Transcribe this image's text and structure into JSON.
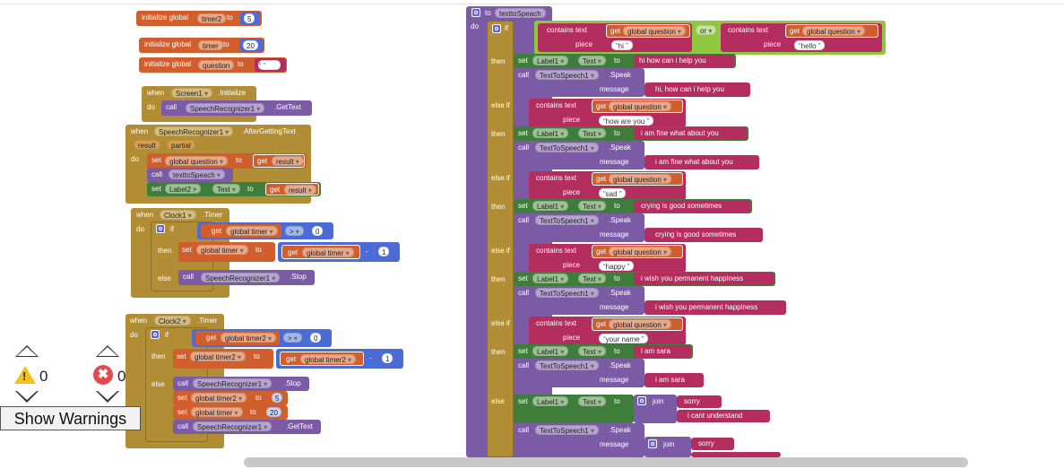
{
  "globals": [
    {
      "kw": "initialize global",
      "name": "timer2",
      "to": "to",
      "value": "5"
    },
    {
      "kw": "initialize global",
      "name": "timer",
      "to": "to",
      "value": "20"
    },
    {
      "kw": "initialize global",
      "name": "question",
      "to": "to",
      "value": ""
    }
  ],
  "kw": {
    "when": "when",
    "do": "do",
    "call": "call",
    "set": "set",
    "to": "to",
    "get": "get",
    "if": "if",
    "then": "then",
    "else": "else",
    "elseif": "else if",
    "result": "result",
    "partial": "partial",
    "contains": "contains text",
    "piece": "piece",
    "message": "message",
    "or": "or",
    "join": "join"
  },
  "screen_init": {
    "comp": "Screen1",
    "event": ".Initialize",
    "call_comp": "SpeechRecognizer1",
    "call_method": ".GetText"
  },
  "after_text": {
    "comp": "SpeechRecognizer1",
    "event": ".AfterGettingText",
    "set_var": "global question",
    "get_var": "result",
    "call_proc": "texttoSpeach",
    "label": "Label2",
    "prop": "Text",
    "get2": "result"
  },
  "clock1": {
    "comp": "Clock1",
    "event": ".Timer",
    "get_var": "global timer",
    "op": ">",
    "zero": "0",
    "set_var": "global timer",
    "get2": "global timer",
    "minus": "-",
    "one": "1",
    "else_comp": "SpeechRecognizer1",
    "else_method": ".Stop"
  },
  "clock2": {
    "comp": "Clock2",
    "event": ".Timer",
    "get_var": "global timer2",
    "op": ">",
    "zero": "0",
    "set_var": "global timer2",
    "get2": "global timer2",
    "minus": "-",
    "one": "1",
    "else_call1": "SpeechRecognizer1",
    "else_m1": ".Stop",
    "set1": "global timer2",
    "val1": "5",
    "set2": "global timer",
    "val2": "20",
    "else_call2": "SpeechRecognizer1",
    "else_m2": ".GetText"
  },
  "proc": {
    "kw": "to",
    "name": "texttoSpeach",
    "var": "global question",
    "label": "Label1",
    "prop": "Text",
    "tts": "TextToSpeech1",
    "speak": ".Speak",
    "if_pieces": [
      "hi",
      "hello"
    ],
    "branches": [
      {
        "piece": "hi",
        "text": "hi how can i help you",
        "message": "hi, how can i help you"
      },
      {
        "piece": "how are you",
        "text": "i am fine what about you",
        "message": "i am fine what about you"
      },
      {
        "piece": "sad",
        "text": "crying is good sometimes",
        "message": "crying is good sometimes"
      },
      {
        "piece": "happy",
        "text": "i wish you permanent happiness",
        "message": "i wish you permanent happiness"
      },
      {
        "piece": "your name",
        "text": "i am sara",
        "message": "i am sara"
      }
    ],
    "else_join": [
      "sorry",
      "i cant understand"
    ],
    "else_msg": "sorry"
  },
  "warnings": {
    "warn_count": "0",
    "error_count": "0",
    "button": "Show Warnings"
  }
}
